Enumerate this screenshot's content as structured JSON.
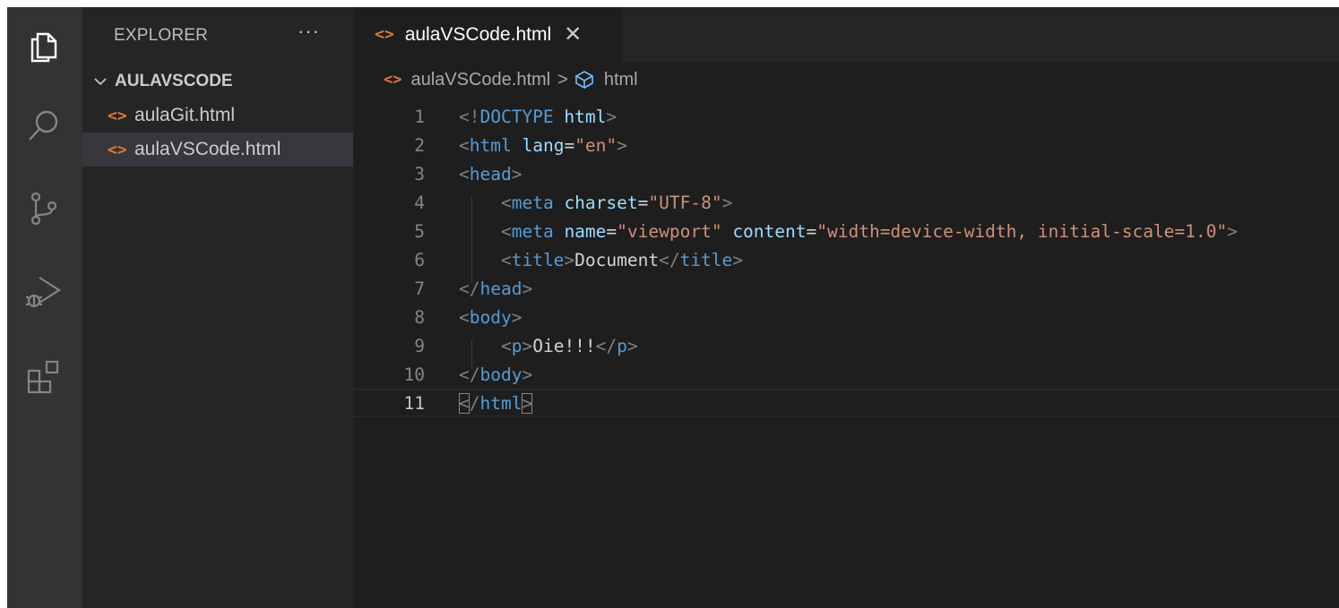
{
  "sidebar": {
    "header": "EXPLORER",
    "more": "···",
    "folder": "AULAVSCODE",
    "files": [
      {
        "icon": "<>",
        "name": "aulaGit.html"
      },
      {
        "icon": "<>",
        "name": "aulaVSCode.html"
      }
    ]
  },
  "activity": [
    "files-icon",
    "search-icon",
    "source-control-icon",
    "run-debug-icon",
    "extensions-icon"
  ],
  "tab": {
    "icon": "<>",
    "label": "aulaVSCode.html",
    "close": "✕"
  },
  "breadcrumb": {
    "icon": "<>",
    "file": "aulaVSCode.html",
    "sep": ">",
    "symbol": "html"
  },
  "editor": {
    "current_line": 11,
    "lines": [
      {
        "n": "1",
        "tokens": [
          [
            "t-punc",
            "<!"
          ],
          [
            "t-tag",
            "DOCTYPE"
          ],
          [
            "t-text",
            " "
          ],
          [
            "t-attr",
            "html"
          ],
          [
            "t-punc",
            ">"
          ]
        ]
      },
      {
        "n": "2",
        "tokens": [
          [
            "t-punc",
            "<"
          ],
          [
            "t-tag",
            "html"
          ],
          [
            "t-text",
            " "
          ],
          [
            "t-attr",
            "lang"
          ],
          [
            "t-text",
            "="
          ],
          [
            "t-str",
            "\"en\""
          ],
          [
            "t-punc",
            ">"
          ]
        ]
      },
      {
        "n": "3",
        "tokens": [
          [
            "t-punc",
            "<"
          ],
          [
            "t-tag",
            "head"
          ],
          [
            "t-punc",
            ">"
          ]
        ]
      },
      {
        "n": "4",
        "tokens": [
          [
            "t-text",
            "    "
          ],
          [
            "t-punc",
            "<"
          ],
          [
            "t-tag",
            "meta"
          ],
          [
            "t-text",
            " "
          ],
          [
            "t-attr",
            "charset"
          ],
          [
            "t-text",
            "="
          ],
          [
            "t-str",
            "\"UTF-8\""
          ],
          [
            "t-punc",
            ">"
          ]
        ]
      },
      {
        "n": "5",
        "tokens": [
          [
            "t-text",
            "    "
          ],
          [
            "t-punc",
            "<"
          ],
          [
            "t-tag",
            "meta"
          ],
          [
            "t-text",
            " "
          ],
          [
            "t-attr",
            "name"
          ],
          [
            "t-text",
            "="
          ],
          [
            "t-str",
            "\"viewport\""
          ],
          [
            "t-text",
            " "
          ],
          [
            "t-attr",
            "content"
          ],
          [
            "t-text",
            "="
          ],
          [
            "t-str",
            "\"width=device-width, initial-scale=1.0\""
          ],
          [
            "t-punc",
            ">"
          ]
        ]
      },
      {
        "n": "6",
        "tokens": [
          [
            "t-text",
            "    "
          ],
          [
            "t-punc",
            "<"
          ],
          [
            "t-tag",
            "title"
          ],
          [
            "t-punc",
            ">"
          ],
          [
            "t-text",
            "Document"
          ],
          [
            "t-punc",
            "</"
          ],
          [
            "t-tag",
            "title"
          ],
          [
            "t-punc",
            ">"
          ]
        ]
      },
      {
        "n": "7",
        "tokens": [
          [
            "t-punc",
            "</"
          ],
          [
            "t-tag",
            "head"
          ],
          [
            "t-punc",
            ">"
          ]
        ]
      },
      {
        "n": "8",
        "tokens": [
          [
            "t-punc",
            "<"
          ],
          [
            "t-tag",
            "body"
          ],
          [
            "t-punc",
            ">"
          ]
        ]
      },
      {
        "n": "9",
        "tokens": [
          [
            "t-text",
            "    "
          ],
          [
            "t-punc",
            "<"
          ],
          [
            "t-tag",
            "p"
          ],
          [
            "t-punc",
            ">"
          ],
          [
            "t-text",
            "Oie!!!"
          ],
          [
            "t-punc",
            "</"
          ],
          [
            "t-tag",
            "p"
          ],
          [
            "t-punc",
            ">"
          ]
        ]
      },
      {
        "n": "10",
        "tokens": [
          [
            "t-punc",
            "</"
          ],
          [
            "t-tag",
            "body"
          ],
          [
            "t-punc",
            ">"
          ]
        ]
      },
      {
        "n": "11",
        "tokens": [
          [
            "t-punc bracket-box",
            "<"
          ],
          [
            "t-punc",
            "/"
          ],
          [
            "t-tag",
            "html"
          ],
          [
            "t-punc bracket-box",
            ">"
          ]
        ]
      }
    ]
  }
}
